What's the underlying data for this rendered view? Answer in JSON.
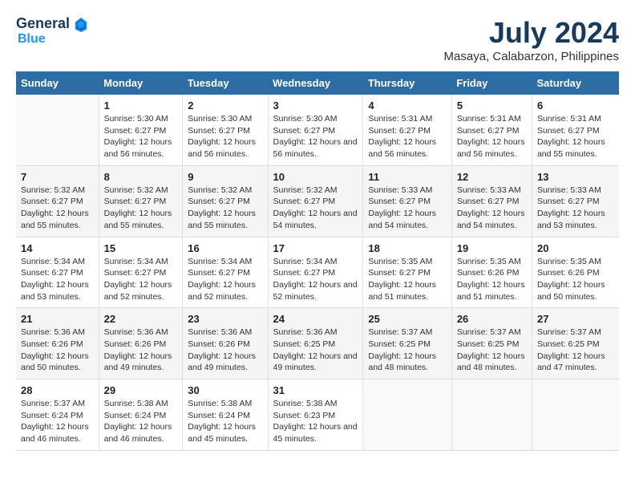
{
  "header": {
    "logo_line1": "General",
    "logo_line2": "Blue",
    "month_year": "July 2024",
    "location": "Masaya, Calabarzon, Philippines"
  },
  "weekdays": [
    "Sunday",
    "Monday",
    "Tuesday",
    "Wednesday",
    "Thursday",
    "Friday",
    "Saturday"
  ],
  "weeks": [
    [
      {
        "day": "",
        "sunrise": "",
        "sunset": "",
        "daylight": ""
      },
      {
        "day": "1",
        "sunrise": "Sunrise: 5:30 AM",
        "sunset": "Sunset: 6:27 PM",
        "daylight": "Daylight: 12 hours and 56 minutes."
      },
      {
        "day": "2",
        "sunrise": "Sunrise: 5:30 AM",
        "sunset": "Sunset: 6:27 PM",
        "daylight": "Daylight: 12 hours and 56 minutes."
      },
      {
        "day": "3",
        "sunrise": "Sunrise: 5:30 AM",
        "sunset": "Sunset: 6:27 PM",
        "daylight": "Daylight: 12 hours and 56 minutes."
      },
      {
        "day": "4",
        "sunrise": "Sunrise: 5:31 AM",
        "sunset": "Sunset: 6:27 PM",
        "daylight": "Daylight: 12 hours and 56 minutes."
      },
      {
        "day": "5",
        "sunrise": "Sunrise: 5:31 AM",
        "sunset": "Sunset: 6:27 PM",
        "daylight": "Daylight: 12 hours and 56 minutes."
      },
      {
        "day": "6",
        "sunrise": "Sunrise: 5:31 AM",
        "sunset": "Sunset: 6:27 PM",
        "daylight": "Daylight: 12 hours and 55 minutes."
      }
    ],
    [
      {
        "day": "7",
        "sunrise": "Sunrise: 5:32 AM",
        "sunset": "Sunset: 6:27 PM",
        "daylight": "Daylight: 12 hours and 55 minutes."
      },
      {
        "day": "8",
        "sunrise": "Sunrise: 5:32 AM",
        "sunset": "Sunset: 6:27 PM",
        "daylight": "Daylight: 12 hours and 55 minutes."
      },
      {
        "day": "9",
        "sunrise": "Sunrise: 5:32 AM",
        "sunset": "Sunset: 6:27 PM",
        "daylight": "Daylight: 12 hours and 55 minutes."
      },
      {
        "day": "10",
        "sunrise": "Sunrise: 5:32 AM",
        "sunset": "Sunset: 6:27 PM",
        "daylight": "Daylight: 12 hours and 54 minutes."
      },
      {
        "day": "11",
        "sunrise": "Sunrise: 5:33 AM",
        "sunset": "Sunset: 6:27 PM",
        "daylight": "Daylight: 12 hours and 54 minutes."
      },
      {
        "day": "12",
        "sunrise": "Sunrise: 5:33 AM",
        "sunset": "Sunset: 6:27 PM",
        "daylight": "Daylight: 12 hours and 54 minutes."
      },
      {
        "day": "13",
        "sunrise": "Sunrise: 5:33 AM",
        "sunset": "Sunset: 6:27 PM",
        "daylight": "Daylight: 12 hours and 53 minutes."
      }
    ],
    [
      {
        "day": "14",
        "sunrise": "Sunrise: 5:34 AM",
        "sunset": "Sunset: 6:27 PM",
        "daylight": "Daylight: 12 hours and 53 minutes."
      },
      {
        "day": "15",
        "sunrise": "Sunrise: 5:34 AM",
        "sunset": "Sunset: 6:27 PM",
        "daylight": "Daylight: 12 hours and 52 minutes."
      },
      {
        "day": "16",
        "sunrise": "Sunrise: 5:34 AM",
        "sunset": "Sunset: 6:27 PM",
        "daylight": "Daylight: 12 hours and 52 minutes."
      },
      {
        "day": "17",
        "sunrise": "Sunrise: 5:34 AM",
        "sunset": "Sunset: 6:27 PM",
        "daylight": "Daylight: 12 hours and 52 minutes."
      },
      {
        "day": "18",
        "sunrise": "Sunrise: 5:35 AM",
        "sunset": "Sunset: 6:27 PM",
        "daylight": "Daylight: 12 hours and 51 minutes."
      },
      {
        "day": "19",
        "sunrise": "Sunrise: 5:35 AM",
        "sunset": "Sunset: 6:26 PM",
        "daylight": "Daylight: 12 hours and 51 minutes."
      },
      {
        "day": "20",
        "sunrise": "Sunrise: 5:35 AM",
        "sunset": "Sunset: 6:26 PM",
        "daylight": "Daylight: 12 hours and 50 minutes."
      }
    ],
    [
      {
        "day": "21",
        "sunrise": "Sunrise: 5:36 AM",
        "sunset": "Sunset: 6:26 PM",
        "daylight": "Daylight: 12 hours and 50 minutes."
      },
      {
        "day": "22",
        "sunrise": "Sunrise: 5:36 AM",
        "sunset": "Sunset: 6:26 PM",
        "daylight": "Daylight: 12 hours and 49 minutes."
      },
      {
        "day": "23",
        "sunrise": "Sunrise: 5:36 AM",
        "sunset": "Sunset: 6:26 PM",
        "daylight": "Daylight: 12 hours and 49 minutes."
      },
      {
        "day": "24",
        "sunrise": "Sunrise: 5:36 AM",
        "sunset": "Sunset: 6:25 PM",
        "daylight": "Daylight: 12 hours and 49 minutes."
      },
      {
        "day": "25",
        "sunrise": "Sunrise: 5:37 AM",
        "sunset": "Sunset: 6:25 PM",
        "daylight": "Daylight: 12 hours and 48 minutes."
      },
      {
        "day": "26",
        "sunrise": "Sunrise: 5:37 AM",
        "sunset": "Sunset: 6:25 PM",
        "daylight": "Daylight: 12 hours and 48 minutes."
      },
      {
        "day": "27",
        "sunrise": "Sunrise: 5:37 AM",
        "sunset": "Sunset: 6:25 PM",
        "daylight": "Daylight: 12 hours and 47 minutes."
      }
    ],
    [
      {
        "day": "28",
        "sunrise": "Sunrise: 5:37 AM",
        "sunset": "Sunset: 6:24 PM",
        "daylight": "Daylight: 12 hours and 46 minutes."
      },
      {
        "day": "29",
        "sunrise": "Sunrise: 5:38 AM",
        "sunset": "Sunset: 6:24 PM",
        "daylight": "Daylight: 12 hours and 46 minutes."
      },
      {
        "day": "30",
        "sunrise": "Sunrise: 5:38 AM",
        "sunset": "Sunset: 6:24 PM",
        "daylight": "Daylight: 12 hours and 45 minutes."
      },
      {
        "day": "31",
        "sunrise": "Sunrise: 5:38 AM",
        "sunset": "Sunset: 6:23 PM",
        "daylight": "Daylight: 12 hours and 45 minutes."
      },
      {
        "day": "",
        "sunrise": "",
        "sunset": "",
        "daylight": ""
      },
      {
        "day": "",
        "sunrise": "",
        "sunset": "",
        "daylight": ""
      },
      {
        "day": "",
        "sunrise": "",
        "sunset": "",
        "daylight": ""
      }
    ]
  ]
}
